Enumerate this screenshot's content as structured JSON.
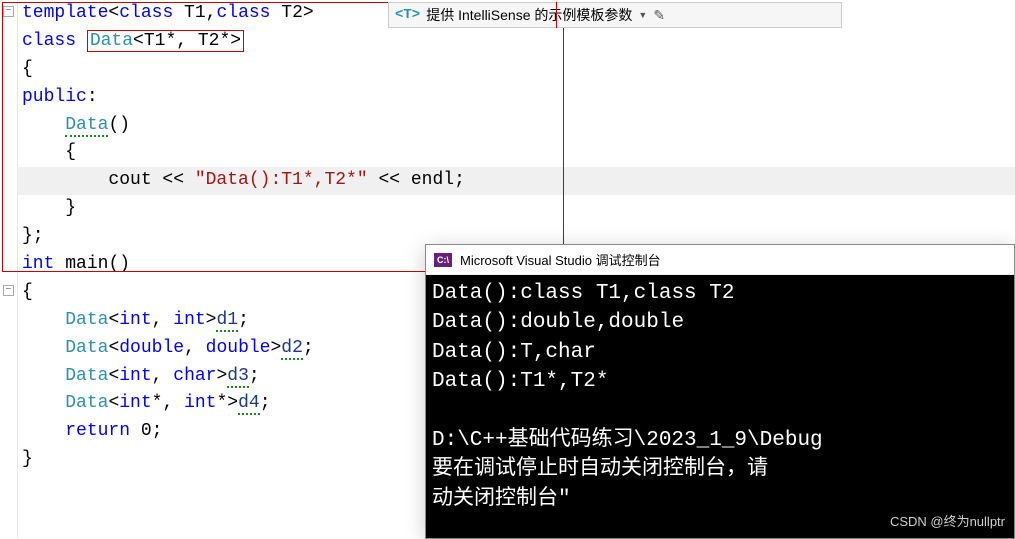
{
  "intellisense": {
    "badge": "<T>",
    "text": "提供 IntelliSense 的示例模板参数"
  },
  "code": {
    "l1_a": "template",
    "l1_b": "<",
    "l1_c": "class",
    "l1_d": " T1,",
    "l1_e": "class",
    "l1_f": " T2>",
    "l2_a": "class",
    "l2_b": " ",
    "l2_c": "Data",
    "l2_d": "<T1*, T2*>",
    "l3": "{",
    "l4_a": "public",
    "l4_b": ":",
    "l5_a": "    ",
    "l5_b": "Data",
    "l5_c": "()",
    "l6": "    {",
    "l7_a": "        cout << ",
    "l7_b": "\"Data():T1*,T2*\"",
    "l7_c": " << endl;",
    "l8": "    }",
    "l9": "};",
    "l10_a": "int",
    "l10_b": " ",
    "l10_c": "main",
    "l10_d": "()",
    "l11": "{",
    "l12_a": "    ",
    "l12_b": "Data",
    "l12_c": "<",
    "l12_d": "int",
    "l12_e": ", ",
    "l12_f": "int",
    "l12_g": ">",
    "l12_h": "d1",
    "l12_i": ";",
    "l13_a": "    ",
    "l13_b": "Data",
    "l13_c": "<",
    "l13_d": "double",
    "l13_e": ", ",
    "l13_f": "double",
    "l13_g": ">",
    "l13_h": "d2",
    "l13_i": ";",
    "l14_a": "    ",
    "l14_b": "Data",
    "l14_c": "<",
    "l14_d": "int",
    "l14_e": ", ",
    "l14_f": "char",
    "l14_g": ">",
    "l14_h": "d3",
    "l14_i": ";",
    "l15_a": "    ",
    "l15_b": "Data",
    "l15_c": "<",
    "l15_d": "int",
    "l15_e": "*, ",
    "l15_f": "int",
    "l15_g": "*>",
    "l15_h": "d4",
    "l15_i": ";",
    "l16_a": "    ",
    "l16_b": "return",
    "l16_c": " 0;",
    "l17": "}"
  },
  "console": {
    "icon_text": "C:\\",
    "title": "Microsoft Visual Studio 调试控制台",
    "line1": "Data():class T1,class T2",
    "line2": "Data():double,double",
    "line3": "Data():T,char",
    "line4": "Data():T1*,T2*",
    "line5": "",
    "line6": "D:\\C++基础代码练习\\2023_1_9\\Debug",
    "line7": "要在调试停止时自动关闭控制台，请",
    "line8": "动关闭控制台\""
  },
  "watermark": "CSDN @终为nullptr"
}
